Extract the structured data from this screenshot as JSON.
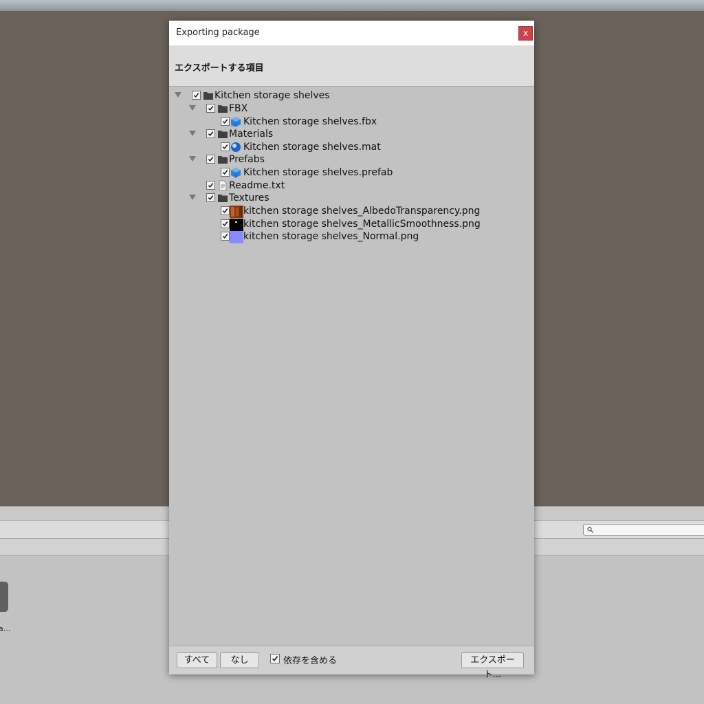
{
  "dialog": {
    "title": "Exporting package",
    "close_label": "x",
    "header": "エクスポートする項目"
  },
  "tree": [
    {
      "label": "Kitchen storage shelves",
      "icon": "folder-icon",
      "expandable": true,
      "checked": true
    },
    {
      "label": "FBX",
      "icon": "folder-icon",
      "expandable": true,
      "checked": true
    },
    {
      "label": "Kitchen storage shelves.fbx",
      "icon": "model-icon",
      "expandable": false,
      "checked": true
    },
    {
      "label": "Materials",
      "icon": "folder-icon",
      "expandable": true,
      "checked": true
    },
    {
      "label": "Kitchen storage shelves.mat",
      "icon": "material-icon",
      "expandable": false,
      "checked": true
    },
    {
      "label": "Prefabs",
      "icon": "folder-icon",
      "expandable": true,
      "checked": true
    },
    {
      "label": "Kitchen storage shelves.prefab",
      "icon": "prefab-icon",
      "expandable": false,
      "checked": true
    },
    {
      "label": "Readme.txt",
      "icon": "text-file-icon",
      "expandable": false,
      "checked": true
    },
    {
      "label": "Textures",
      "icon": "folder-icon",
      "expandable": true,
      "checked": true
    },
    {
      "label": "kitchen storage shelves_AlbedoTransparency.png",
      "icon": "albedo-texture-icon",
      "expandable": false,
      "checked": true
    },
    {
      "label": "kitchen storage shelves_MetallicSmoothness.png",
      "icon": "metallic-texture-icon",
      "expandable": false,
      "checked": true
    },
    {
      "label": "kitchen storage shelves_Normal.png",
      "icon": "normal-texture-icon",
      "expandable": false,
      "checked": true
    }
  ],
  "footer": {
    "all_label": "すべて",
    "none_label": "なし",
    "include_dependencies_label": "依存を含める",
    "include_dependencies_checked": true,
    "export_label": "エクスポート..."
  },
  "background": {
    "asset_label": "a…"
  },
  "colors": {
    "close_button": "#c9454a",
    "normal_texture": "#8a8aff",
    "model_blue": "#2f7fd6"
  }
}
